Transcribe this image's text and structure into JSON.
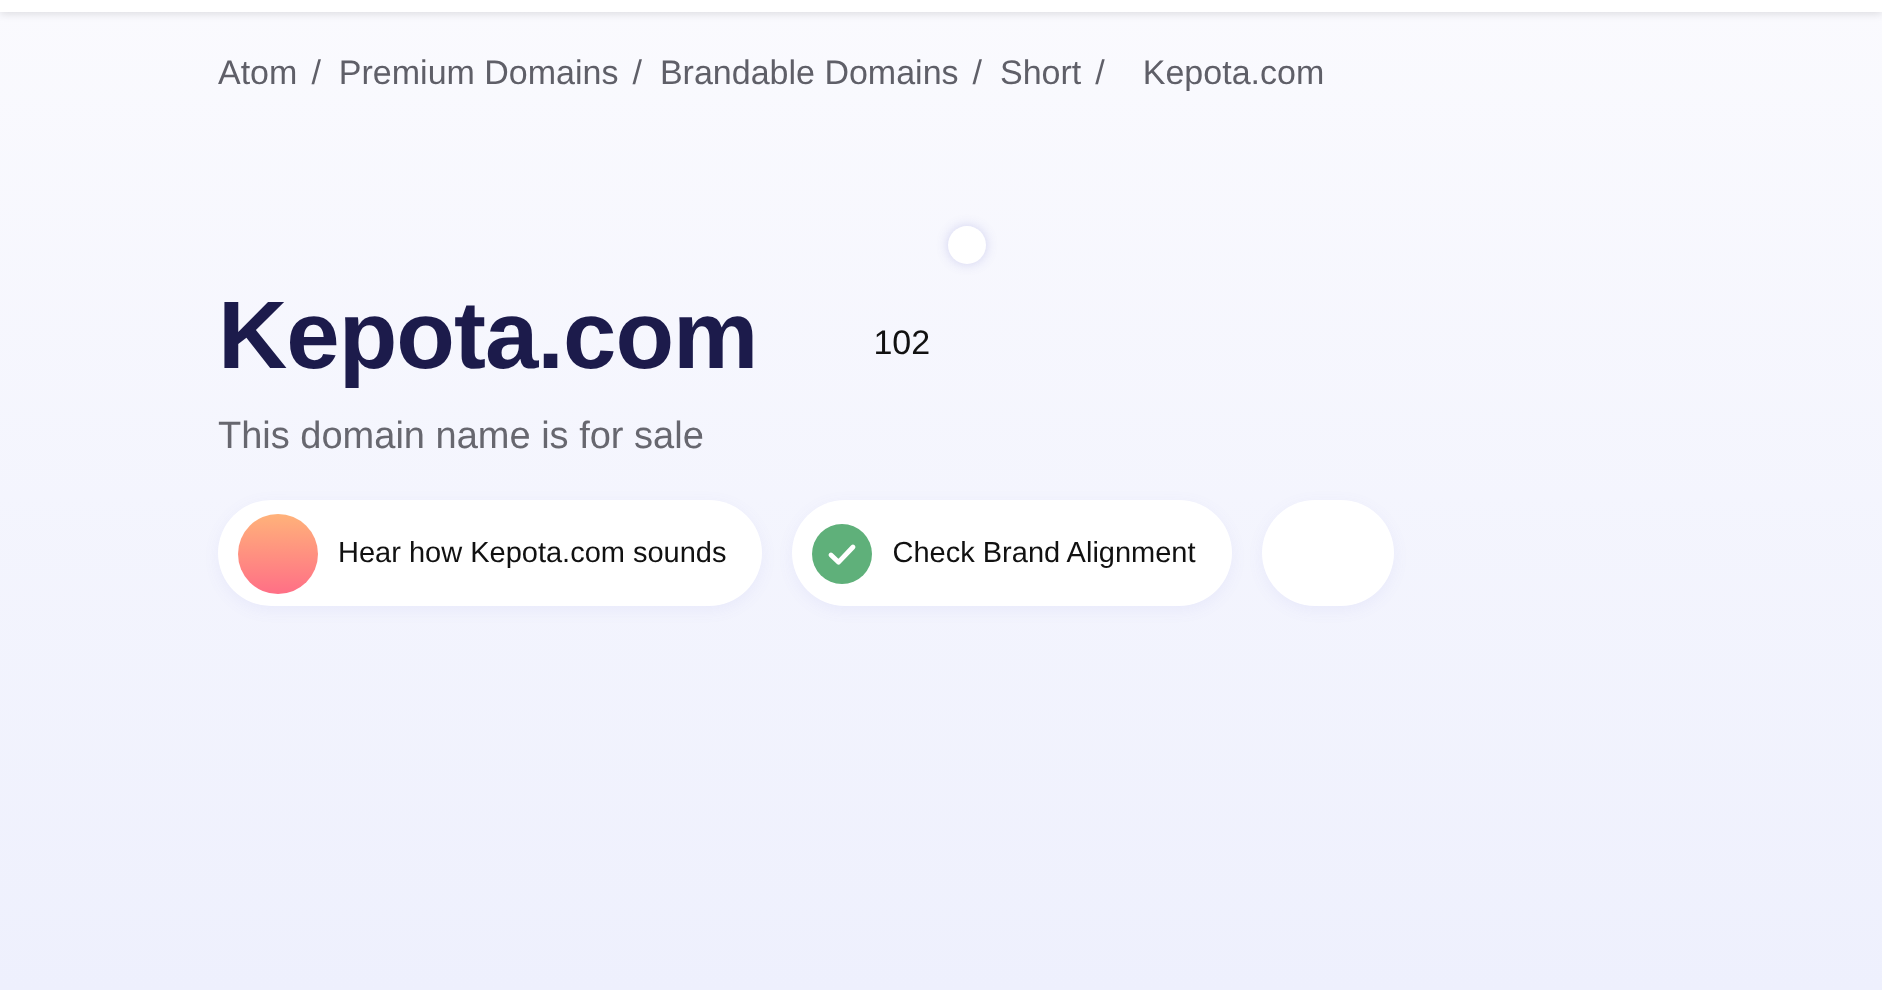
{
  "breadcrumb": {
    "separator": "/",
    "items": [
      {
        "label": "Atom"
      },
      {
        "label": "Premium Domains"
      },
      {
        "label": "Brandable Domains"
      },
      {
        "label": "Short"
      },
      {
        "label": "Kepota.com"
      }
    ]
  },
  "domain": {
    "name": "Kepota.com",
    "count": "102",
    "subtitle": "This domain name is for sale"
  },
  "actions": [
    {
      "kind": "audio",
      "label": "Hear how Kepota.com sounds"
    },
    {
      "kind": "check",
      "label": "Check Brand Alignment"
    },
    {
      "kind": "blank"
    }
  ]
}
